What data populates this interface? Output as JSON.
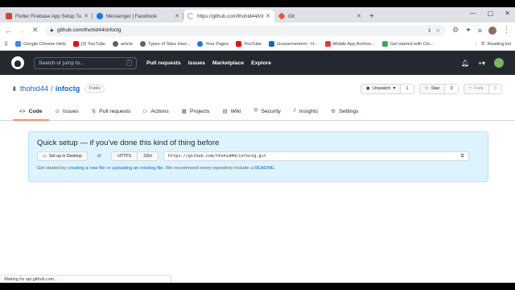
{
  "browser": {
    "tabs": [
      {
        "title": "Flutter Firebase App Setup Tuto",
        "color": "#e53935"
      },
      {
        "title": "Messenger | Facebook",
        "color": "#1877f2"
      },
      {
        "title": "https://github.com/thohid44/inf",
        "color": "#9aa0a6"
      },
      {
        "title": "Git",
        "color": "#f05033"
      }
    ],
    "address": "github.com/thohid44/infoctg",
    "bookmarks": [
      {
        "label": "Google Chrome Help",
        "color": "#4285f4"
      },
      {
        "label": "(3) YouTube",
        "color": "#ff0000"
      },
      {
        "label": "article",
        "color": "#5f6368"
      },
      {
        "label": "Types of Sites Havi...",
        "color": "#5f6368"
      },
      {
        "label": "Your Pages",
        "color": "#1877f2"
      },
      {
        "label": "YouTube",
        "color": "#ff0000"
      },
      {
        "label": "Gouvernement - H...",
        "color": "#1565c0"
      },
      {
        "label": "Mobile App Archive...",
        "color": "#e53935"
      },
      {
        "label": "Get started with Clo...",
        "color": "#34a853"
      }
    ],
    "reading_list": "Reading list",
    "status": "Waiting for api.github.com..."
  },
  "github": {
    "search_placeholder": "Search or jump to...",
    "search_key": "/",
    "nav": [
      "Pull requests",
      "Issues",
      "Marketplace",
      "Explore"
    ]
  },
  "repo": {
    "owner": "thohid44",
    "name": "infoctg",
    "visibility": "Public",
    "watch_label": "Unwatch",
    "watch_count": "1",
    "star_label": "Star",
    "star_count": "0",
    "fork_label": "Fork",
    "fork_count": "0",
    "tabs": [
      {
        "label": "Code",
        "icon": "<>"
      },
      {
        "label": "Issues",
        "icon": "⊙"
      },
      {
        "label": "Pull requests",
        "icon": "⇅"
      },
      {
        "label": "Actions",
        "icon": "▷"
      },
      {
        "label": "Projects",
        "icon": "▦"
      },
      {
        "label": "Wiki",
        "icon": "▤"
      },
      {
        "label": "Security",
        "icon": "⛨"
      },
      {
        "label": "Insights",
        "icon": "⫽"
      },
      {
        "label": "Settings",
        "icon": "⚙"
      }
    ]
  },
  "quick_setup": {
    "title": "Quick setup — if you've done this kind of thing before",
    "desktop_button": "Set up in Desktop",
    "or": "or",
    "https": "HTTPS",
    "ssh": "SSH",
    "clone_url": "https://github.com/thohid44/infoctg.git",
    "text_prefix": "Get started by ",
    "link_new": "creating a new file",
    "text_or": " or ",
    "link_upload": "uploading an existing file",
    "text_mid": ". We recommend every repository include a ",
    "link_readme": "README",
    "text_end": "."
  }
}
